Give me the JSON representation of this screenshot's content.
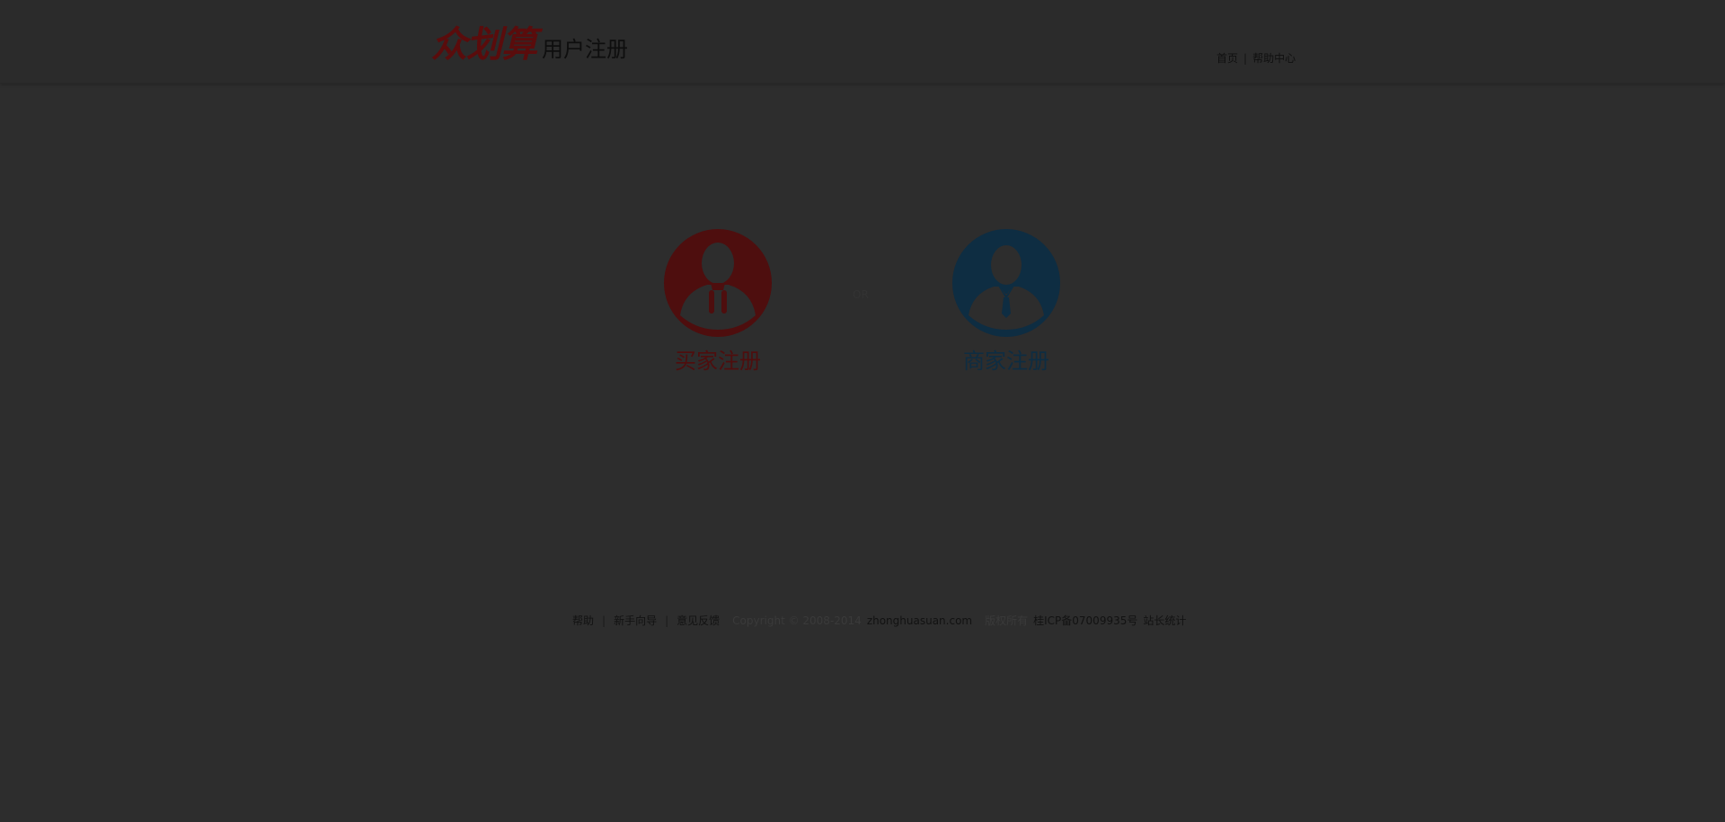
{
  "header": {
    "brand": "众划算",
    "subtitle": "用户注册",
    "nav": [
      {
        "label": "首页"
      },
      {
        "label": "帮助中心"
      }
    ]
  },
  "main": {
    "buyer": {
      "label": "买家注册",
      "color": "#4e0e0e"
    },
    "or": "OR",
    "seller": {
      "label": "商家注册",
      "color": "#0e2d42"
    }
  },
  "footer": {
    "links": [
      {
        "label": "帮助"
      },
      {
        "label": "新手向导"
      },
      {
        "label": "意见反馈"
      }
    ],
    "copyright": "Copyright © 2008-2014",
    "domain": "zhonghuasuan.com",
    "rights": "版权所有",
    "icp": "桂ICP备07009935号",
    "stats": "站长统计"
  }
}
